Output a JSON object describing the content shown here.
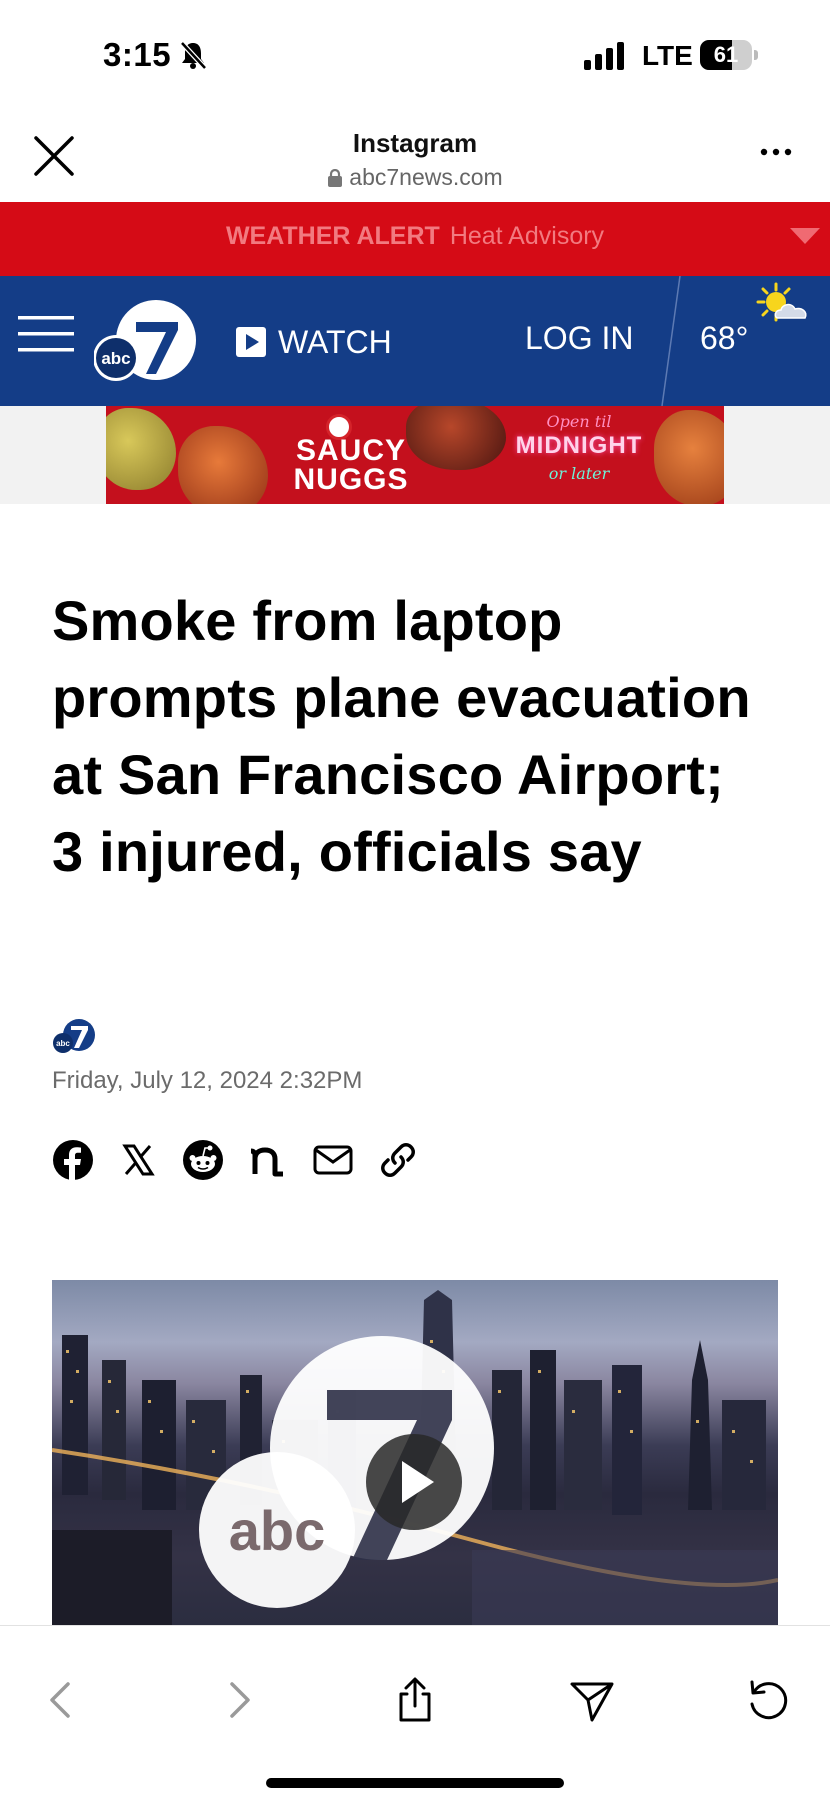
{
  "status_bar": {
    "time": "3:15",
    "network": "LTE",
    "battery_level": "61"
  },
  "browser": {
    "title": "Instagram",
    "url": "abc7news.com"
  },
  "weather_alert": {
    "label": "WEATHER ALERT",
    "text": "Heat Advisory",
    "background": "#d50b16"
  },
  "nav": {
    "watch_label": "WATCH",
    "login_label": "LOG IN",
    "temperature": "68°",
    "background": "#143d87",
    "logo_text": "abc",
    "logo_number": "7"
  },
  "ad": {
    "title_line1": "SAUCY",
    "title_line2": "NUGGS",
    "sign_top": "Open til",
    "sign_mid": "MIDNIGHT",
    "sign_bottom": "or later"
  },
  "article": {
    "headline": "Smoke from laptop prompts plane evacuation at San Francisco Airport; 3 injured, officials say",
    "date": "Friday, July 12, 2024 2:32PM"
  },
  "share_icons": [
    "facebook-icon",
    "x-icon",
    "reddit-icon",
    "nextdoor-icon",
    "email-icon",
    "link-icon"
  ],
  "toolbar_icons": [
    "back-icon",
    "forward-icon",
    "share-icon",
    "send-icon",
    "reload-icon"
  ]
}
